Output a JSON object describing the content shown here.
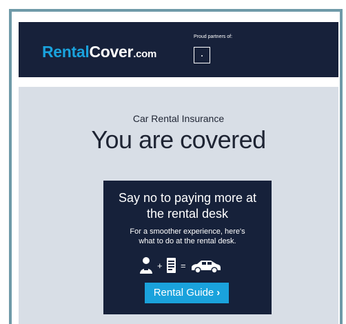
{
  "header": {
    "logo_part1": "Rental",
    "logo_part2": "Cover",
    "logo_part3": ".com",
    "partners_label": "Proud partners of:"
  },
  "main": {
    "subtitle": "Car Rental Insurance",
    "title": "You are covered"
  },
  "card": {
    "heading_line1": "Say no to paying more at",
    "heading_line2": "the rental desk",
    "body_line1": "For a smoother experience, here's",
    "body_line2": "what to do at the rental desk.",
    "equation_icons": [
      "person-icon",
      "document-icon",
      "car-icon"
    ],
    "plus_symbol": "+",
    "equals_symbol": "=",
    "button_label": "Rental Guide",
    "button_icon": "chevron-right-icon"
  },
  "colors": {
    "accent": "#1aa2dc",
    "navy": "#16213a",
    "frame_border": "#6f9aa8",
    "content_bg": "#d8dee6"
  }
}
